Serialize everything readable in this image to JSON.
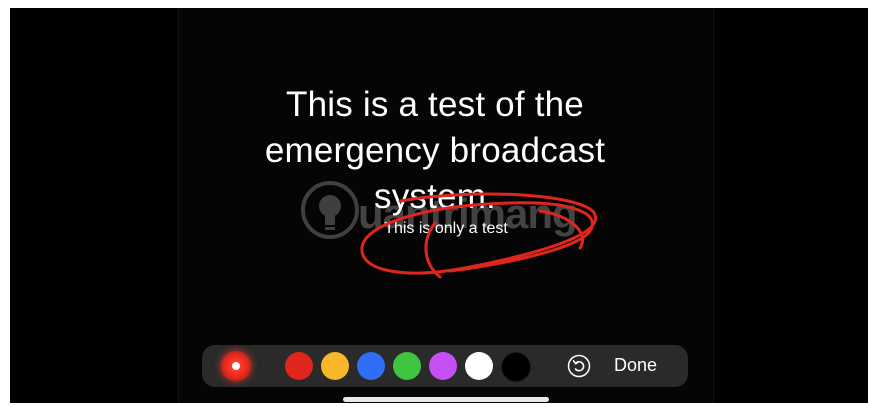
{
  "canvas": {
    "headline_lines": [
      "This is a test of the",
      "emergency broadcast",
      "system."
    ],
    "subtitle": "This is only a test"
  },
  "watermark": {
    "text": "uantrimang",
    "icon": "lightbulb-icon"
  },
  "markup": {
    "annotation_color": "#e0261c"
  },
  "toolbar": {
    "active_tool": "pen",
    "active_tool_color": "#ff3b30",
    "colors": [
      "#e0261c",
      "#f8b62a",
      "#2f6ef5",
      "#3ec43e",
      "#c44ff5",
      "#ffffff",
      "#000000"
    ],
    "undo_icon": "undo-icon",
    "done_label": "Done"
  }
}
